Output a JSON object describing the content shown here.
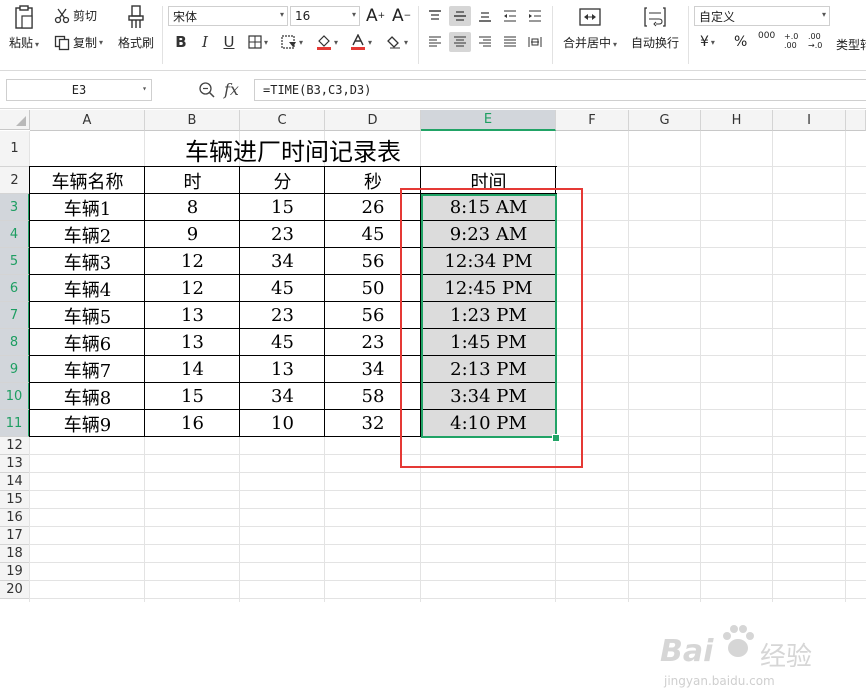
{
  "toolbar": {
    "paste_label": "粘贴",
    "cut_label": "剪切",
    "copy_label": "复制",
    "format_painter_label": "格式刷",
    "font_name": "宋体",
    "font_size": "16",
    "merge_center_label": "合并居中",
    "wrap_text_label": "自动换行",
    "number_format": "自定义",
    "currency_symbol": "¥",
    "percent_symbol": "%",
    "thousands_symbol": "000",
    "inc_decimal_label": "+.0 .00",
    "dec_decimal_label": ".00 →.0",
    "type_convert_label": "类型转",
    "bold": "B",
    "italic": "I",
    "underline": "U",
    "grow_font": "A",
    "shrink_font": "A"
  },
  "formula_bar": {
    "name_box": "E3",
    "fx_label": "fx",
    "formula": "=TIME(B3,C3,D3)"
  },
  "columns": [
    "A",
    "B",
    "C",
    "D",
    "E",
    "F",
    "G",
    "H",
    "I"
  ],
  "rows": [
    "1",
    "2",
    "3",
    "4",
    "5",
    "6",
    "7",
    "8",
    "9",
    "10",
    "11",
    "12",
    "13",
    "14",
    "15",
    "16",
    "17",
    "18",
    "19",
    "20"
  ],
  "sheet": {
    "title": "车辆进厂时间记录表",
    "headers": [
      "车辆名称",
      "时",
      "分",
      "秒",
      "时间"
    ],
    "data": [
      [
        "车辆1",
        "8",
        "15",
        "26",
        "8:15 AM"
      ],
      [
        "车辆2",
        "9",
        "23",
        "45",
        "9:23 AM"
      ],
      [
        "车辆3",
        "12",
        "34",
        "56",
        "12:34 PM"
      ],
      [
        "车辆4",
        "12",
        "45",
        "50",
        "12:45 PM"
      ],
      [
        "车辆5",
        "13",
        "23",
        "56",
        "1:23 PM"
      ],
      [
        "车辆6",
        "13",
        "45",
        "23",
        "1:45 PM"
      ],
      [
        "车辆7",
        "14",
        "13",
        "34",
        "2:13 PM"
      ],
      [
        "车辆8",
        "15",
        "34",
        "58",
        "3:34 PM"
      ],
      [
        "车辆9",
        "16",
        "10",
        "32",
        "4:10 PM"
      ]
    ]
  },
  "selection": {
    "active_cell": "E3",
    "range": "E3:E11",
    "accent_color": "#21a366"
  },
  "annotation_color": "#e53935",
  "watermark": {
    "brand": "Bai",
    "brand2": "经验",
    "url": "jingyan.baidu.com"
  }
}
